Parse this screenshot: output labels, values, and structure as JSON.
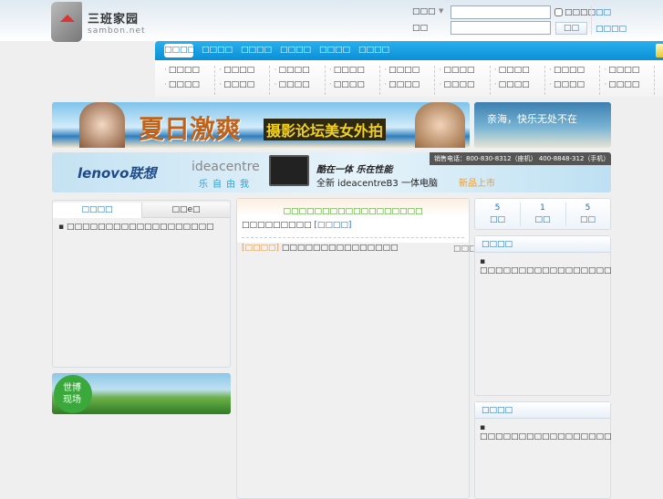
{
  "header": {
    "logo_cn": "三班家园",
    "logo_en": "sambon.net",
    "search_type": "□□□",
    "password_label": "□□",
    "remember_label": "□□□□",
    "register_link": "□□",
    "login_button": "□□",
    "forgot_link": "□□□□"
  },
  "nav": {
    "tabs": [
      "□□□□",
      "□□□□",
      "□□□□",
      "□□□□",
      "□□□□",
      "□□□□"
    ]
  },
  "subnav": {
    "row1": [
      "□□□□",
      "□□□□",
      "□□□□",
      "□□□□",
      "□□□□",
      "□□□□",
      "□□□□",
      "□□□□",
      "□□□□"
    ],
    "row2": [
      "□□□□",
      "□□□□",
      "□□□□",
      "□□□□",
      "□□□□",
      "□□□□",
      "□□□□",
      "□□□□",
      "□□□□"
    ]
  },
  "banners": {
    "summer_title": "夏日激爽",
    "summer_sub": "摄影论坛美女外拍",
    "sea_text": "亲海，快乐无处不在",
    "lenovo_logo": "lenovo联想",
    "idea": "ideacentre",
    "idea_slogan": "乐自由我",
    "hotline": "销售电话：800-830-8312（座机） 400-8848-312（手机）",
    "headline": "酷在一体 乐在性能",
    "product": "全新 ideacentreB3 一体电脑",
    "new_tag": "新品上市",
    "expo_text": "世博现场"
  },
  "left": {
    "tabs": [
      "□□□□",
      "□□e□"
    ],
    "items": [
      "□□□□□□□□□□□□□□□□□□□"
    ]
  },
  "middle": {
    "title": "□□□□□□□□□□□□□□□□□□",
    "subtitle": "□□□□□□□□□",
    "subtitle_link": "[□□□□]",
    "post_tag": "[□□□□]",
    "post_title": "□□□□□□□□□□□□□□□",
    "post_meta": "□□□"
  },
  "right": {
    "stats": [
      {
        "value": "5",
        "label": "□□"
      },
      {
        "value": "1",
        "label": "□□"
      },
      {
        "value": "5",
        "label": "□□"
      }
    ],
    "box1_title": "□□□□",
    "box1_items": [
      "□□□□□□□□□□□□□□□□□"
    ],
    "box2_title": "□□□□",
    "box2_items": [
      "□□□□□□□□□□□□□□□□□"
    ]
  }
}
